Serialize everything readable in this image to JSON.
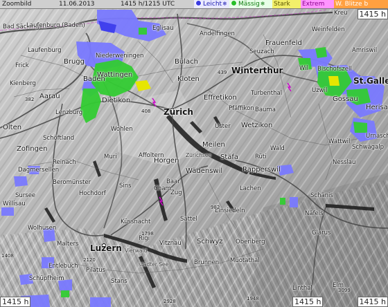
{
  "header": {
    "title": "Zoombild",
    "date": "11.06.2013",
    "altitude_time": "1415 h/1215 UTC"
  },
  "legend": [
    {
      "label": "Leicht",
      "icon": "snowflake-icon"
    },
    {
      "label": "Mässig",
      "icon": "snowflake-icon"
    },
    {
      "label": "Stark"
    },
    {
      "label": "Extrem"
    },
    {
      "label": "W. Blitze",
      "suffix": "b"
    }
  ],
  "corner_labels": {
    "top_right": "1415 h",
    "bottom_left": "1415 h",
    "bottom_mid": "1415 h",
    "bottom_right": "1415 h"
  },
  "places": {
    "zurich": "Zürich",
    "winterthur": "Winterthur",
    "st_gallen": "St.Gallen",
    "luzern": "Luzern",
    "wattingen": "Wattingen",
    "baden": "Baden",
    "brugg": "Brugg",
    "aarau": "Aarau",
    "olten": "Olten",
    "zofingen": "Zofingen",
    "frick": "Frick",
    "laufenburg": "Laufenburg",
    "bad_sackingen": "Bad Säckingen",
    "dietikon": "Dietikon",
    "bulach": "Bülach",
    "kloten": "Kloten",
    "effretikon": "Effretikon",
    "uster": "Uster",
    "wetzikon": "Wetzikon",
    "meilen": "Meilen",
    "stafa": "Stäfa",
    "horgen": "Horgen",
    "wadenswil": "Wädenswil",
    "rapperswil": "Rapperswil",
    "ruti": "Rüti",
    "baar": "Baar",
    "zug": "Zug",
    "cham": "Cham",
    "schwyz": "Schwyz",
    "einsiedeln": "Einsiedeln",
    "frauenfeld": "Frauenfeld",
    "wil": "Wil",
    "gossau": "Gossau",
    "herisau": "Herisau",
    "amriswil": "Amriswil",
    "weinfelden": "Weinfelden",
    "uzwil": "Uzwil",
    "bischofszell": "Bischofszell",
    "lenzburg": "Lenzburg",
    "wohlen": "Wohlen",
    "muri": "Muri",
    "affoltern": "Affoltern",
    "sursee": "Sursee",
    "willisau": "Willisau",
    "wolhusen": "Wolhusen",
    "malters": "Malters",
    "kussnacht": "Küssnacht",
    "brunnen": "Brunnen",
    "glarus": "Glarus",
    "nafels": "Näfels",
    "schanis": "Schänis",
    "lachen": "Lachen",
    "wattwil": "Wattwil",
    "pilatus": "Pilatus",
    "rigi": "Rigi",
    "sattel": "Sattel",
    "oberiberg": "Oberiberg",
    "muotathal": "Muotathal",
    "linthal": "Linthal",
    "elm": "Elm",
    "stans": "Stans",
    "niederweningen": "Niederweningen",
    "kreuzlingen": "Kreu",
    "seuzach": "Seuzach",
    "turbenthal": "Turbenthal",
    "bauma": "Bauma",
    "pfaffikon": "Pfäffikon",
    "wald": "Wald",
    "nesslau": "Nesslau",
    "urnasch": "Urnäsch",
    "schwagalp": "Schwägalp",
    "entlebuch": "Entlebuch",
    "schupfheim": "Schüpfheim",
    "hochdorf": "Hochdorf",
    "beromunster": "Beromünster",
    "reinach": "Reinach",
    "schoftland": "Schöftland",
    "dagmersellen": "Dagmersellen",
    "sins": "Sins",
    "vitznau": "Vitznau",
    "gersau": "Gersau",
    "walensee_lake": "Walen",
    "zurichsee_lake": "Zürichsee",
    "vierwald_lake": "Vierwald",
    "stadter_see": "städter See",
    "klaus": "Glarus",
    "andelfingen": "Andelfingen",
    "eglisau": "Eglisau",
    "kaiserstuhl": "Kaiserstuhl",
    "waldshut": "Waldshut",
    "laufenburg_baden": "Laufenburg (Baden)",
    "rheinfelden": "Rheinfelden",
    "kreuzberg": "Kienberg",
    "hochwald": "Hochwald",
    "lindau": "Lindau",
    "hw_1798": "1798",
    "hw_2120": "2120",
    "hw_1408": "1408",
    "hw_2928": "2928",
    "hw_3099": "3099",
    "hw_1948": "1948",
    "hw_982": "982",
    "hw_439": "439",
    "hw_408": "408",
    "hw_382": "382",
    "hw_1600": "1600"
  }
}
